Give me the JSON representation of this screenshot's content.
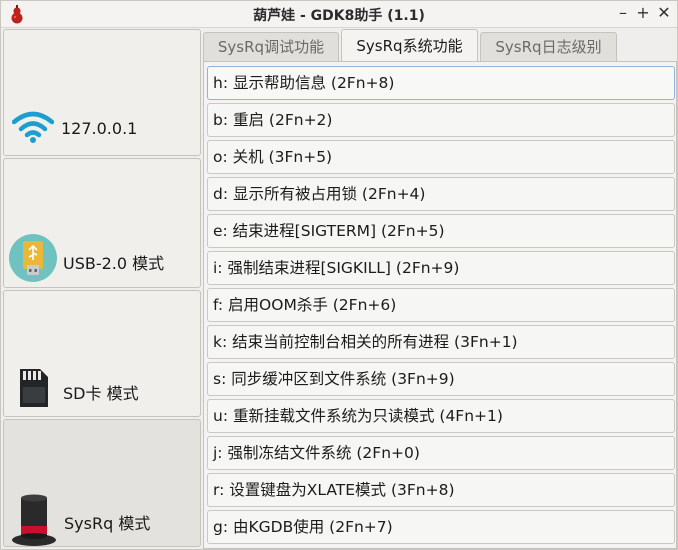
{
  "window": {
    "title": "葫芦娃 - GDK8助手 (1.1)",
    "minimize": "–",
    "maximize": "+",
    "close": "✕"
  },
  "sidebar": {
    "items": [
      {
        "label": "127.0.0.1",
        "icon": "wifi-icon"
      },
      {
        "label": "USB-2.0 模式",
        "icon": "usb-drive-icon"
      },
      {
        "label": "SD卡 模式",
        "icon": "sd-card-icon"
      },
      {
        "label": "SysRq 模式",
        "icon": "magic-hat-icon"
      }
    ]
  },
  "tabs": [
    {
      "label": "SysRq调试功能"
    },
    {
      "label": "SysRq系统功能"
    },
    {
      "label": "SysRq日志级别"
    }
  ],
  "commands": [
    "h: 显示帮助信息 (2Fn+8)",
    "b: 重启 (2Fn+2)",
    "o: 关机 (3Fn+5)",
    "d: 显示所有被占用锁 (2Fn+4)",
    "e: 结束进程[SIGTERM] (2Fn+5)",
    "i: 强制结束进程[SIGKILL] (2Fn+9)",
    "f: 启用OOM杀手 (2Fn+6)",
    "k: 结束当前控制台相关的所有进程 (3Fn+1)",
    "s: 同步缓冲区到文件系统 (3Fn+9)",
    "u: 重新挂载文件系统为只读模式 (4Fn+1)",
    "j: 强制冻结文件系统 (2Fn+0)",
    "r: 设置键盘为XLATE模式 (3Fn+8)",
    "g: 由KGDB使用 (2Fn+7)"
  ],
  "colors": {
    "wifi": "#1a9fd0",
    "usb_body": "#e9b83a",
    "usb_circle": "#6fc2c0",
    "hat": "#2a2a2a",
    "hat_band": "#c8102e",
    "app_icon": "#c0201c",
    "focus": "#8fb3d9"
  },
  "active_tab": 1,
  "active_sidebar": 3
}
